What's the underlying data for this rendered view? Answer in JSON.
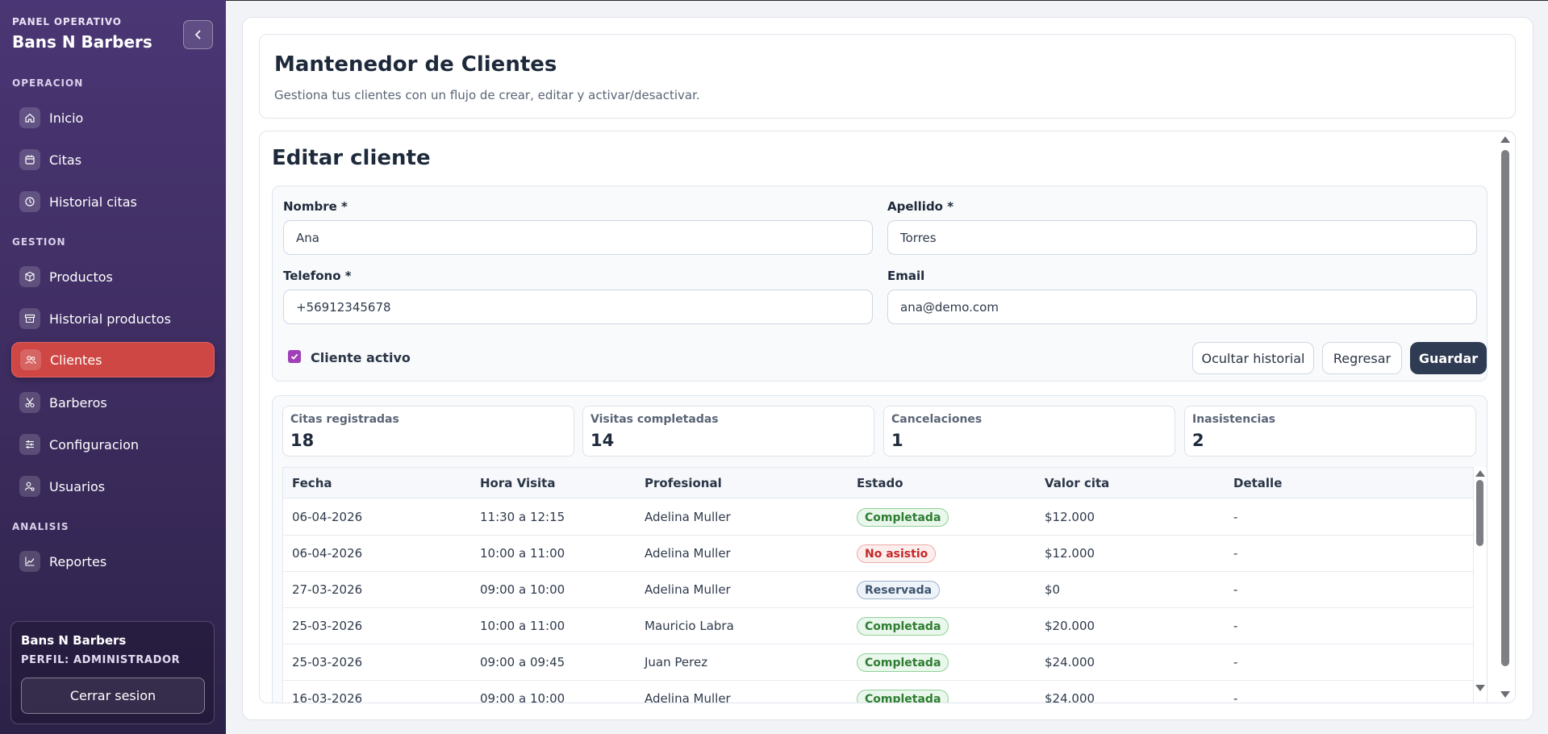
{
  "sidebar": {
    "kicker": "PANEL OPERATIVO",
    "brand": "Bans N Barbers",
    "sections": {
      "operacion": "OPERACION",
      "gestion": "GESTION",
      "analisis": "ANALISIS"
    },
    "items": {
      "inicio": {
        "label": "Inicio",
        "icon": "home-icon"
      },
      "citas": {
        "label": "Citas",
        "icon": "calendar-icon"
      },
      "historial_citas": {
        "label": "Historial citas",
        "icon": "clock-icon"
      },
      "productos": {
        "label": "Productos",
        "icon": "box-icon"
      },
      "historial_productos": {
        "label": "Historial productos",
        "icon": "archive-icon"
      },
      "clientes": {
        "label": "Clientes",
        "icon": "users-icon",
        "active": true
      },
      "barberos": {
        "label": "Barberos",
        "icon": "scissors-icon"
      },
      "configuracion": {
        "label": "Configuracion",
        "icon": "sliders-icon"
      },
      "usuarios": {
        "label": "Usuarios",
        "icon": "user-cog-icon"
      },
      "reportes": {
        "label": "Reportes",
        "icon": "chart-line-icon"
      }
    },
    "user": {
      "name": "Bans N Barbers",
      "role": "PERFIL: ADMINISTRADOR",
      "logout": "Cerrar sesion"
    }
  },
  "header": {
    "title": "Mantenedor de Clientes",
    "subtitle": "Gestiona tus clientes con un flujo de crear, editar y activar/desactivar."
  },
  "form": {
    "title": "Editar cliente",
    "nombre_label": "Nombre *",
    "nombre_value": "Ana",
    "apellido_label": "Apellido *",
    "apellido_value": "Torres",
    "telefono_label": "Telefono *",
    "telefono_value": "+56912345678",
    "email_label": "Email",
    "email_value": "ana@demo.com",
    "activo_label": "Cliente activo",
    "activo_checked": true,
    "ocultar_label": "Ocultar historial",
    "regresar_label": "Regresar",
    "guardar_label": "Guardar"
  },
  "stats": {
    "citas": {
      "label": "Citas registradas",
      "value": "18"
    },
    "visitas": {
      "label": "Visitas completadas",
      "value": "14"
    },
    "cancelaciones": {
      "label": "Cancelaciones",
      "value": "1"
    },
    "inasistencias": {
      "label": "Inasistencias",
      "value": "2"
    }
  },
  "table": {
    "headers": {
      "fecha": "Fecha",
      "hora": "Hora Visita",
      "profesional": "Profesional",
      "estado": "Estado",
      "valor": "Valor cita",
      "detalle": "Detalle"
    },
    "rows": [
      {
        "fecha": "06-04-2026",
        "hora": "11:30 a 12:15",
        "profesional": "Adelina Muller",
        "estado": "Completada",
        "valor": "$12.000",
        "detalle": "-"
      },
      {
        "fecha": "06-04-2026",
        "hora": "10:00 a 11:00",
        "profesional": "Adelina Muller",
        "estado": "No asistio",
        "valor": "$12.000",
        "detalle": "-"
      },
      {
        "fecha": "27-03-2026",
        "hora": "09:00 a 10:00",
        "profesional": "Adelina Muller",
        "estado": "Reservada",
        "valor": "$0",
        "detalle": "-"
      },
      {
        "fecha": "25-03-2026",
        "hora": "10:00 a 11:00",
        "profesional": "Mauricio Labra",
        "estado": "Completada",
        "valor": "$20.000",
        "detalle": "-"
      },
      {
        "fecha": "25-03-2026",
        "hora": "09:00 a 09:45",
        "profesional": "Juan Perez",
        "estado": "Completada",
        "valor": "$24.000",
        "detalle": "-"
      },
      {
        "fecha": "16-03-2026",
        "hora": "09:00 a 10:00",
        "profesional": "Adelina Muller",
        "estado": "Completada",
        "valor": "$24.000",
        "detalle": "-"
      }
    ]
  },
  "colors": {
    "sidebar_bg": "#4a3674",
    "active_item": "#cf4744",
    "primary_dark": "#2f3b52",
    "checkbox": "#a13fb9",
    "status_completada": "#2e7d32",
    "status_no_asistio": "#c62828",
    "status_reservada": "#3f5570"
  }
}
